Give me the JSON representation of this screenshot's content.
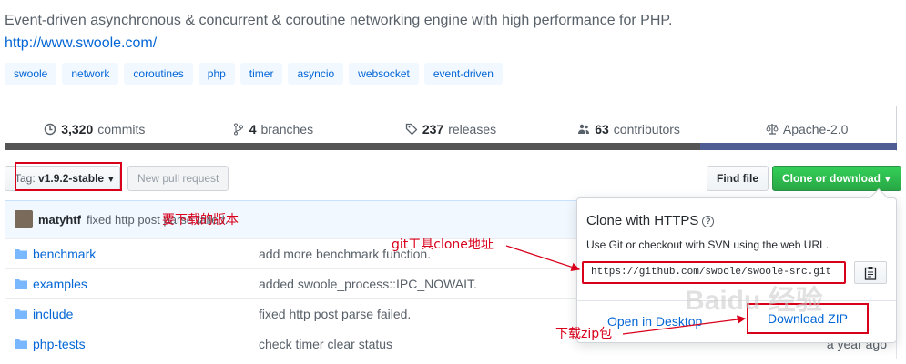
{
  "repo": {
    "description": "Event-driven asynchronous & concurrent & coroutine networking engine with high performance for PHP.",
    "homepage": "http://www.swoole.com/",
    "topics": [
      "swoole",
      "network",
      "coroutines",
      "php",
      "timer",
      "asyncio",
      "websocket",
      "event-driven"
    ]
  },
  "summary": {
    "commits_count": "3,320",
    "commits_label": "commits",
    "branches_count": "4",
    "branches_label": "branches",
    "releases_count": "237",
    "releases_label": "releases",
    "contributors_count": "63",
    "contributors_label": "contributors",
    "license": "Apache-2.0"
  },
  "toolbar": {
    "branch_prefix": "Tag:",
    "branch_value": "v1.9.2-stable",
    "new_pr": "New pull request",
    "find_file": "Find file",
    "clone_label": "Clone or download"
  },
  "commit": {
    "author": "matyhtf",
    "message": "fixed http post parse failed."
  },
  "files": [
    {
      "name": "benchmark",
      "message": "add more benchmark function.",
      "age": ""
    },
    {
      "name": "examples",
      "message": "added swoole_process::IPC_NOWAIT.",
      "age": ""
    },
    {
      "name": "include",
      "message": "fixed http post parse failed.",
      "age": ""
    },
    {
      "name": "php-tests",
      "message": "check timer clear status",
      "age": "a year ago"
    }
  ],
  "clone_dropdown": {
    "title": "Clone with HTTPS",
    "help": "?",
    "subtitle": "Use Git or checkout with SVN using the web URL.",
    "url": "https://github.com/swoole/swoole-src.git",
    "open_desktop": "Open in Desktop",
    "download_zip": "Download ZIP"
  },
  "annotations": {
    "version": "要下载的版本",
    "git_clone": "git工具clone地址",
    "zip": "下载zip包"
  },
  "watermark": "Baidu 经验",
  "colors": {
    "link": "#0366d6",
    "annotation_red": "#d9001b",
    "clone_green": "#28a745"
  }
}
